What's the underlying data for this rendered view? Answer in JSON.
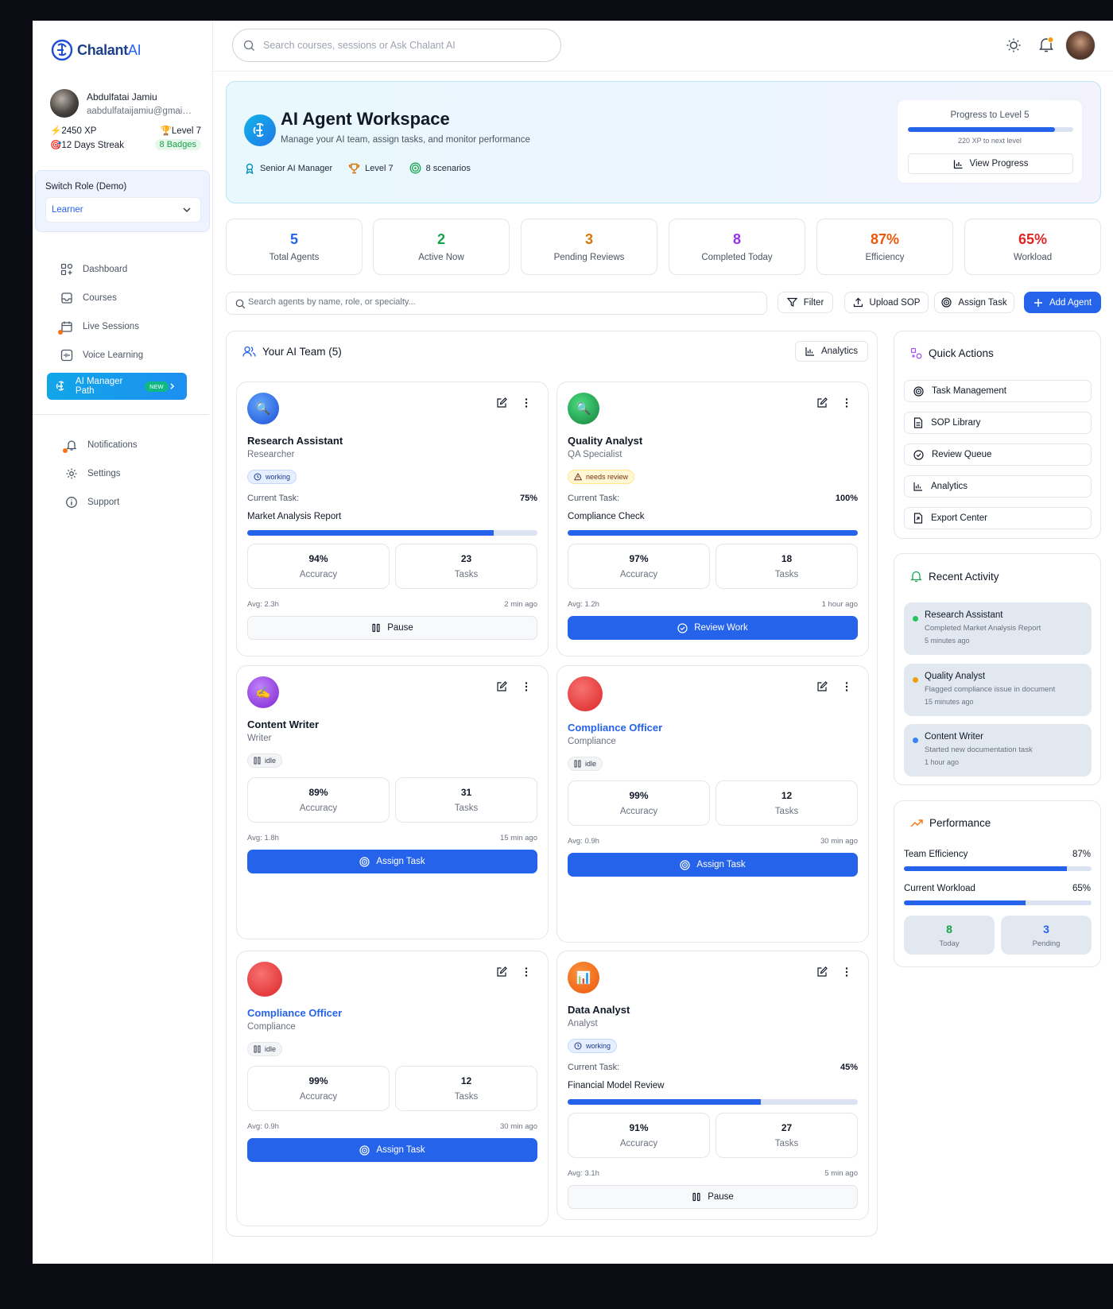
{
  "sidebar": {
    "logo": {
      "brand": "Chalant",
      "suffix": "AI"
    },
    "profile": {
      "name": "Abdulfatai Jamiu",
      "email": "aabdulfataijamiu@gmail.com"
    },
    "stats": {
      "xp": "⚡2450 XP",
      "level": "🏆Level 7",
      "streak": "🎯12 Days Streak",
      "badges": "8 Badges"
    },
    "role_switch": {
      "title": "Switch Role (Demo)",
      "value": "Learner"
    },
    "nav": [
      {
        "label": "Dashboard",
        "icon": "dashboard-icon"
      },
      {
        "label": "Courses",
        "icon": "inbox-icon"
      },
      {
        "label": "Live Sessions",
        "icon": "calendar-icon"
      },
      {
        "label": "Voice Learning",
        "icon": "audio-wave-icon"
      },
      {
        "label": "AI Manager Path",
        "icon": "brain-icon",
        "badge": "NEW"
      }
    ],
    "secondary_nav": [
      {
        "label": "Notifications",
        "icon": "bell-icon"
      },
      {
        "label": "Settings",
        "icon": "gear-icon"
      },
      {
        "label": "Support",
        "icon": "info-icon"
      }
    ]
  },
  "topbar": {
    "search_placeholder": "Search courses, sessions or Ask Chalant AI"
  },
  "hero": {
    "title": "AI Agent Workspace",
    "subtitle": "Manage your AI team, assign tasks, and monitor performance",
    "chips": [
      "Senior AI Manager",
      "Level 7",
      "8 scenarios"
    ],
    "progress": {
      "title": "Progress to Level 5",
      "value": 0.89,
      "note": "220 XP to next level",
      "button": "View Progress"
    }
  },
  "stats": [
    {
      "value": "5",
      "label": "Total Agents",
      "color": "#2563eb"
    },
    {
      "value": "2",
      "label": "Active Now",
      "color": "#16a34a"
    },
    {
      "value": "3",
      "label": "Pending Reviews",
      "color": "#d97706"
    },
    {
      "value": "8",
      "label": "Completed Today",
      "color": "#9333ea"
    },
    {
      "value": "87%",
      "label": "Efficiency",
      "color": "#ea580c"
    },
    {
      "value": "65%",
      "label": "Workload",
      "color": "#dc2626"
    }
  ],
  "toolbar": {
    "search_placeholder": "Search agents by name, role, or specialty...",
    "filter": "Filter",
    "upload_sop": "Upload SOP",
    "assign_task": "Assign Task",
    "add_agent": "Add Agent"
  },
  "team": {
    "title": "Your AI Team (5)",
    "analytics_button": "Analytics",
    "current_task_label": "Current Task:",
    "accuracy_label": "Accuracy",
    "tasks_label": "Tasks",
    "agents": [
      {
        "name": "Research Assistant",
        "role": "Researcher",
        "status": "working",
        "emoji": "🔍",
        "task_pct": "75%",
        "task_progress": 0.85,
        "task_name": "Market Analysis Report",
        "accuracy": "94%",
        "tasks": "23",
        "avg": "Avg: 2.3h",
        "ago": "2 min ago",
        "button": "Pause"
      },
      {
        "name": "Quality Analyst",
        "role": "QA Specialist",
        "status": "needs review",
        "emoji": "🔍",
        "task_pct": "100%",
        "task_progress": 1.0,
        "task_name": "Compliance Check",
        "accuracy": "97%",
        "tasks": "18",
        "avg": "Avg: 1.2h",
        "ago": "1 hour ago",
        "button": "Review Work"
      },
      {
        "name": "Content Writer",
        "role": "Writer",
        "status": "idle",
        "emoji": "✍️",
        "accuracy": "89%",
        "tasks": "31",
        "avg": "Avg: 1.8h",
        "ago": "15 min ago",
        "button": "Assign Task"
      },
      {
        "name": "Compliance Officer",
        "role": "Compliance",
        "status": "idle",
        "emoji": "",
        "accuracy": "99%",
        "tasks": "12",
        "avg": "Avg: 0.9h",
        "ago": "30 min ago",
        "button": "Assign Task"
      },
      {
        "name": "Compliance Officer",
        "role": "Compliance",
        "status": "idle",
        "emoji": "",
        "accuracy": "99%",
        "tasks": "12",
        "avg": "Avg: 0.9h",
        "ago": "30 min ago",
        "button": "Assign Task"
      },
      {
        "name": "Data Analyst",
        "role": "Analyst",
        "status": "working",
        "emoji": "📊",
        "task_pct": "45%",
        "task_progress": 0.665,
        "task_name": "Financial Model Review",
        "accuracy": "91%",
        "tasks": "27",
        "avg": "Avg: 3.1h",
        "ago": "5 min ago",
        "button": "Pause"
      }
    ]
  },
  "quick_actions": {
    "title": "Quick Actions",
    "items": [
      {
        "label": "Task Management",
        "icon": "target-icon"
      },
      {
        "label": "SOP Library",
        "icon": "document-icon"
      },
      {
        "label": "Review Queue",
        "icon": "check-circle-icon"
      },
      {
        "label": "Analytics",
        "icon": "bar-chart-icon"
      },
      {
        "label": "Export Center",
        "icon": "export-icon"
      }
    ]
  },
  "recent_activity": {
    "title": "Recent Activity",
    "items": [
      {
        "title": "Research Assistant",
        "desc": "Completed Market Analysis Report",
        "when": "5 minutes ago",
        "color": "#22c55e"
      },
      {
        "title": "Quality Analyst",
        "desc": "Flagged compliance issue in document",
        "when": "15 minutes ago",
        "color": "#f59e0b"
      },
      {
        "title": "Content Writer",
        "desc": "Started new documentation task",
        "when": "1 hour ago",
        "color": "#3b82f6"
      }
    ]
  },
  "performance": {
    "title": "Performance",
    "metrics": [
      {
        "label": "Team Efficiency",
        "pct": "87%",
        "value": 0.87
      },
      {
        "label": "Current Workload",
        "pct": "65%",
        "value": 0.65
      }
    ],
    "today": {
      "value": "8",
      "label": "Today"
    },
    "pending": {
      "value": "3",
      "label": "Pending"
    }
  }
}
